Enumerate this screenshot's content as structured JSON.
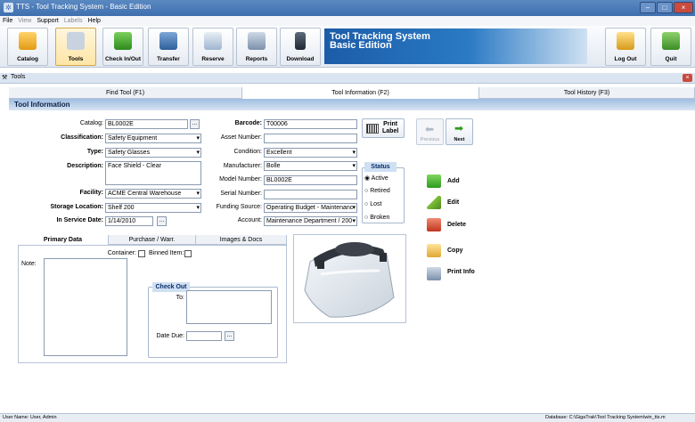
{
  "window": {
    "title": "TTS - Tool Tracking System - Basic Edition",
    "minimize": "–",
    "maximize": "□",
    "close": "×"
  },
  "menu": [
    "File",
    "View",
    "Support",
    "Labels",
    "Help"
  ],
  "ribbon": {
    "buttons": [
      "Catalog",
      "Tools",
      "Check In/Out",
      "Transfer",
      "Reserve",
      "Reports",
      "Download"
    ],
    "banner_line1": "Tool Tracking System",
    "banner_line2": "Basic Edition",
    "logout": "Log Out",
    "quit": "Quit"
  },
  "subbar": {
    "title": "Tools",
    "close": "×"
  },
  "tabs": [
    "Find Tool (F1)",
    "Tool Information (F2)",
    "Tool History (F3)"
  ],
  "section_title": "Tool Information",
  "form": {
    "catalog_label": "Catalog:",
    "catalog": "BL0002E",
    "classification_label": "Classification:",
    "classification": "Safety Equipment",
    "type_label": "Type:",
    "type": "Safety Glasses",
    "description_label": "Description:",
    "description": "Face Shield - Clear",
    "facility_label": "Facility:",
    "facility": "ACME Central Warehouse",
    "storage_label": "Storage Location:",
    "storage": "Shelf 200",
    "inservice_label": "In Service Date:",
    "inservice": "1/14/2010",
    "barcode_label": "Barcode:",
    "barcode": "T00006",
    "asset_label": "Asset Number:",
    "asset": "",
    "condition_label": "Condition:",
    "condition": "Excellent",
    "manufacturer_label": "Manufacturer:",
    "manufacturer": "Bolle",
    "model_label": "Model Number:",
    "model": "BL0002E",
    "serial_label": "Serial Number:",
    "serial": "",
    "funding_label": "Funding Source:",
    "funding": "Operating Budget - Maintenanc",
    "account_label": "Account:",
    "account": "Maintenance Department / 200",
    "ellipsis": "..."
  },
  "print_label": {
    "line1": "Print",
    "line2": "Label"
  },
  "nav": {
    "previous": "Previous",
    "next": "Next"
  },
  "status": {
    "title": "Status",
    "options": [
      "Active",
      "Retired",
      "Lost",
      "Broken"
    ],
    "selected": "Active"
  },
  "actions": [
    "Add",
    "Edit",
    "Delete",
    "Copy",
    "Print Info"
  ],
  "subtabs": [
    "Primary Data",
    "Purchase / Warr.",
    "Images & Docs"
  ],
  "primary": {
    "container_label": "Container:",
    "binned_label": "Binned Item:",
    "note_label": "Note:",
    "checkout_title": "Check Out",
    "to_label": "To:",
    "date_due_label": "Date Due:"
  },
  "statusbar": {
    "user": "User Name: User, Admin",
    "database": "Database: C:\\GigaTrak\\Tool Tracking System\\win_tts.m"
  }
}
